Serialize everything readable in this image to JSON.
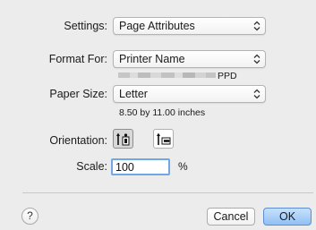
{
  "settings": {
    "label": "Settings:",
    "value": "Page Attributes"
  },
  "format_for": {
    "label": "Format For:",
    "value": "Printer Name",
    "ppd": "PPD"
  },
  "paper_size": {
    "label": "Paper Size:",
    "value": "Letter",
    "dimensions": "8.50 by 11.00 inches"
  },
  "orientation": {
    "label": "Orientation:",
    "selected": "portrait"
  },
  "scale": {
    "label": "Scale:",
    "value": "100",
    "unit": "%"
  },
  "footer": {
    "help": "?",
    "cancel": "Cancel",
    "ok": "OK"
  },
  "colors": {
    "accent": "#6fa7e8",
    "ok_button": "#8fc0f4"
  }
}
